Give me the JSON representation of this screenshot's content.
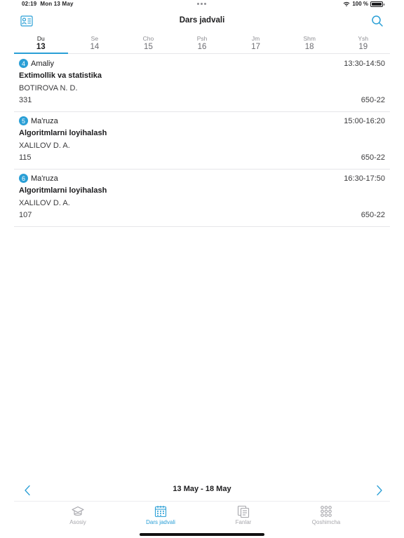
{
  "status": {
    "time": "02:19",
    "date": "Mon 13 May",
    "battery": "100 %"
  },
  "nav": {
    "title": "Dars jadvali"
  },
  "days": [
    {
      "name": "Du",
      "date": "13",
      "active": true
    },
    {
      "name": "Se",
      "date": "14",
      "active": false
    },
    {
      "name": "Cho",
      "date": "15",
      "active": false
    },
    {
      "name": "Psh",
      "date": "16",
      "active": false
    },
    {
      "name": "Jm",
      "date": "17",
      "active": false
    },
    {
      "name": "Shm",
      "date": "18",
      "active": false
    },
    {
      "name": "Ysh",
      "date": "19",
      "active": false
    }
  ],
  "lessons": [
    {
      "number": "4",
      "type": "Amaliy",
      "time": "13:30-14:50",
      "subject": "Extimollik va statistika",
      "teacher": "BOTIROVA N. D.",
      "room": "331",
      "group": "650-22"
    },
    {
      "number": "5",
      "type": "Ma'ruza",
      "time": "15:00-16:20",
      "subject": "Algoritmlarni loyihalash",
      "teacher": "XALILOV D. A.",
      "room": "115",
      "group": "650-22"
    },
    {
      "number": "6",
      "type": "Ma'ruza",
      "time": "16:30-17:50",
      "subject": "Algoritmlarni loyihalash",
      "teacher": "XALILOV D. A.",
      "room": "107",
      "group": "650-22"
    }
  ],
  "week": {
    "range": "13 May - 18 May"
  },
  "tabs": [
    {
      "label": "Asosiy",
      "icon": "graduation-cap-icon",
      "active": false
    },
    {
      "label": "Dars jadvali",
      "icon": "calendar-icon",
      "active": true
    },
    {
      "label": "Fanlar",
      "icon": "documents-icon",
      "active": false
    },
    {
      "label": "Qoshimcha",
      "icon": "grid-icon",
      "active": false
    }
  ],
  "colors": {
    "accent": "#2a9fd6",
    "text": "#1c1c1e",
    "muted": "#a6a6ab",
    "divider": "#e6e6e9"
  }
}
